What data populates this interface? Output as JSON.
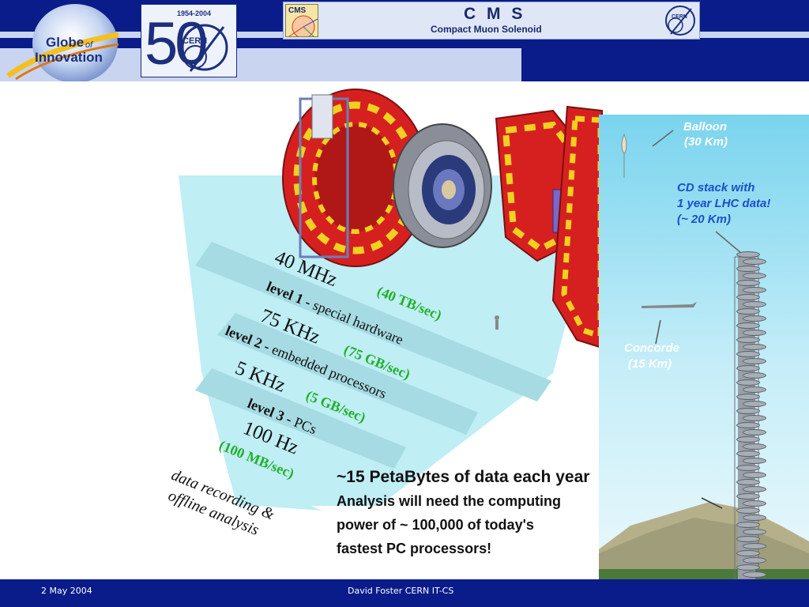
{
  "header": {
    "globe_logo_text_1": "Globe",
    "globe_logo_text_2": "of",
    "globe_logo_text_3": "Innovation",
    "cern50_years": "1954-2004",
    "cern50_number": "50",
    "cern_label": "CERN",
    "cms_badge": "CMS",
    "cms_title": "C M S",
    "cms_subtitle": "Compact Muon Solenoid"
  },
  "trigger": {
    "rate_40mhz": "40 MHz",
    "data_40tb": "(40 TB/sec)",
    "level1_bold": "level 1 -",
    "level1_rest": " special hardware",
    "rate_75khz": "75 KHz",
    "data_75gb": "(75 GB/sec)",
    "level2_bold": "level 2 -",
    "level2_rest": " embedded processors",
    "rate_5khz": "5 KHz",
    "data_5gb": "(5 GB/sec)",
    "level3_bold": "level 3 -",
    "level3_rest": " PCs",
    "rate_100hz": "100 Hz",
    "data_100mb": "(100 MB/sec)",
    "recording_line1": "data recording &",
    "recording_line2": "offline analysis"
  },
  "petabytes": {
    "headline": "~15 PetaBytes of data each year",
    "line1": "Analysis will need the computing",
    "line2": "power of ~ 100,000 of today's",
    "line3": "fastest PC processors!"
  },
  "sky": {
    "balloon_1": "Balloon",
    "balloon_2": "(30 Km)",
    "cd_1": "CD stack with",
    "cd_2": "1 year LHC data!",
    "cd_3": "(~ 20 Km)",
    "concorde_1": "Concorde",
    "concorde_2": "(15 Km)"
  },
  "footer": {
    "date": "2 May 2004",
    "author": "David Foster CERN IT-CS"
  },
  "colors": {
    "navy": "#0a1b8a",
    "funnel": "#bfeef5",
    "band": "#a6dbe3",
    "rate_green": "#22b02a",
    "sky_blue": "#1a50c8",
    "sky_white": "#ffffff"
  }
}
